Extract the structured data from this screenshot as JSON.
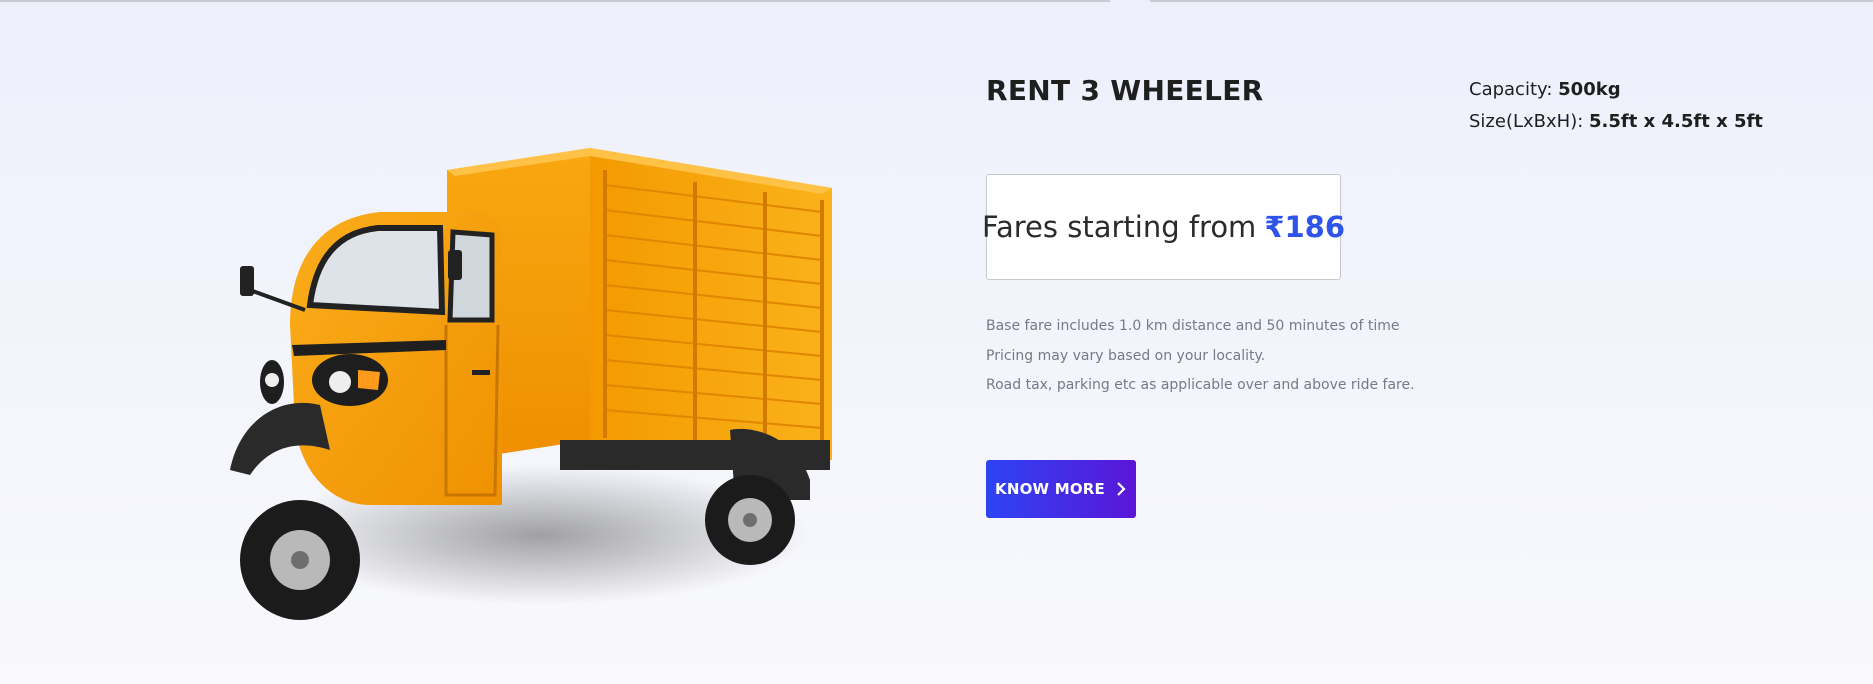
{
  "product": {
    "title": "RENT 3 WHEELER",
    "image_alt": "orange-three-wheeler-cargo-vehicle"
  },
  "specs": {
    "capacity_label": "Capacity:",
    "capacity_value": "500kg",
    "size_label": "Size(LxBxH):",
    "size_value": "5.5ft x 4.5ft x 5ft"
  },
  "fare": {
    "prefix": "Fares starting from",
    "amount": "₹186"
  },
  "notes": [
    "Base fare includes 1.0 km distance and 50 minutes of time",
    "Pricing may vary based on your locality.",
    "Road tax, parking etc as applicable over and above ride fare."
  ],
  "cta": {
    "label": "KNOW MORE",
    "icon": "chevron-right-icon"
  },
  "colors": {
    "accent": "#2f55e8",
    "button_start": "#2d44f4",
    "button_end": "#5b16d8",
    "vehicle": "#f6a000"
  }
}
